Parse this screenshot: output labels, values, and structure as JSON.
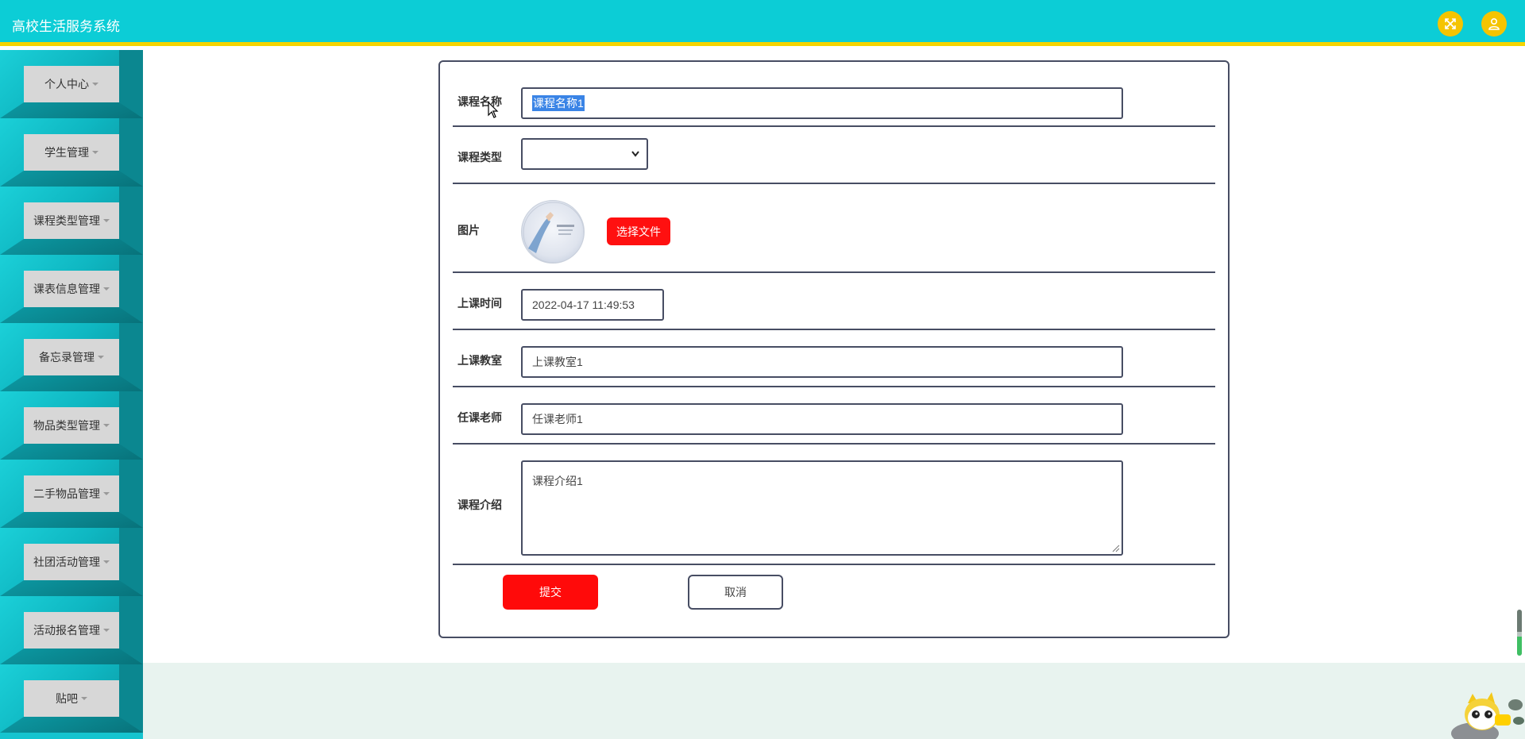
{
  "header": {
    "title": "高校生活服务系统",
    "expand_icon": "fullscreen-icon",
    "user_icon": "user-icon",
    "accent_color": "#0ccdd6",
    "stripe_color": "#f5d400"
  },
  "sidebar": {
    "items": [
      {
        "label": "个人中心"
      },
      {
        "label": "学生管理"
      },
      {
        "label": "课程类型管理"
      },
      {
        "label": "课表信息管理"
      },
      {
        "label": "备忘录管理"
      },
      {
        "label": "物品类型管理"
      },
      {
        "label": "二手物品管理"
      },
      {
        "label": "社团活动管理"
      },
      {
        "label": "活动报名管理"
      },
      {
        "label": "贴吧"
      }
    ]
  },
  "form": {
    "course_name": {
      "label": "课程名称",
      "value": "课程名称1"
    },
    "course_type": {
      "label": "课程类型",
      "value": ""
    },
    "image": {
      "label": "图片",
      "button": "选择文件"
    },
    "class_time": {
      "label": "上课时间",
      "value": "2022-04-17 11:49:53"
    },
    "classroom": {
      "label": "上课教室",
      "value": "上课教室1"
    },
    "teacher": {
      "label": "任课老师",
      "value": "任课老师1"
    },
    "intro": {
      "label": "课程介绍",
      "value": "课程介绍1"
    },
    "submit_label": "提交",
    "cancel_label": "取消",
    "primary_color": "#ff0a0a"
  }
}
